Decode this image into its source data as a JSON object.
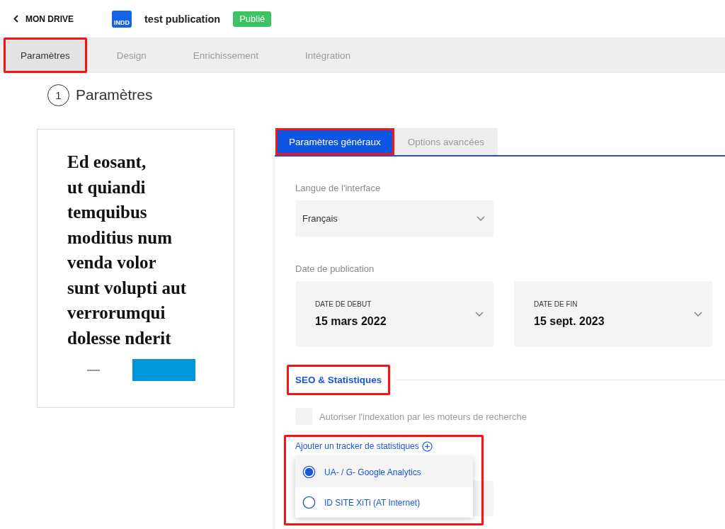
{
  "header": {
    "back_label": "MON DRIVE",
    "file_badge": "INDD",
    "title": "test publication",
    "status": "Publié"
  },
  "tabs": [
    {
      "label": "Paramètres",
      "selected": true,
      "highlighted": true
    },
    {
      "label": "Design",
      "selected": false,
      "highlighted": false
    },
    {
      "label": "Enrichissement",
      "selected": false,
      "highlighted": false
    },
    {
      "label": "Intégration",
      "selected": false,
      "highlighted": false
    }
  ],
  "step": {
    "number": "1",
    "title": "Paramètres"
  },
  "preview": {
    "heading_lines": [
      "Ed eosant,",
      "ut quiandi",
      "temquibus",
      "moditius num",
      "venda volor",
      "sunt volupti aut",
      "verrorumqui",
      "dolesse nderit"
    ]
  },
  "subtabs": [
    {
      "label": "Paramètres généraux",
      "selected": true,
      "highlighted": true
    },
    {
      "label": "Options avancées",
      "selected": false,
      "highlighted": false
    }
  ],
  "language": {
    "label": "Langue de l'interface",
    "value": "Français"
  },
  "publication_date": {
    "label": "Date de publication",
    "fields": [
      {
        "label": "DATE DE DEBUT",
        "value": "15 mars 2022"
      },
      {
        "label": "DATE DE FIN",
        "value": "15 sept. 2023"
      }
    ]
  },
  "seo": {
    "title": "SEO & Statistiques",
    "highlighted": true,
    "indexing": {
      "label": "Autoriser l'indexation par les moteurs de recherche",
      "checked": false
    },
    "tracker": {
      "label": "Ajouter un tracker de statistiques",
      "highlighted": true,
      "options": [
        {
          "label": "UA- / G- Google Analytics",
          "selected": true
        },
        {
          "label": "ID SITE XiTi (AT Internet)",
          "selected": false
        }
      ]
    }
  }
}
